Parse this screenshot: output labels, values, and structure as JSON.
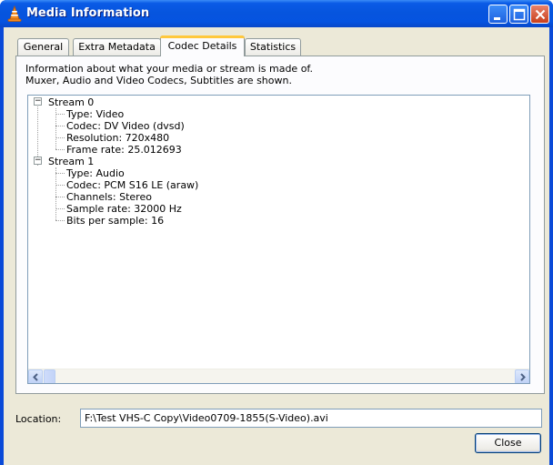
{
  "window": {
    "title": "Media Information",
    "controls": [
      "minimize-icon",
      "maximize-icon",
      "close-icon"
    ]
  },
  "tabs": [
    {
      "label": "General",
      "active": false
    },
    {
      "label": "Extra Metadata",
      "active": false
    },
    {
      "label": "Codec Details",
      "active": true
    },
    {
      "label": "Statistics",
      "active": false
    }
  ],
  "codec": {
    "info_line1": "Information about what your media or stream is made of.",
    "info_line2": "Muxer, Audio and Video Codecs, Subtitles are shown.",
    "streams": [
      {
        "label": "Stream 0",
        "expander": "−",
        "details": [
          "Type: Video",
          "Codec: DV Video (dvsd)",
          "Resolution: 720x480",
          "Frame rate: 25.012693"
        ]
      },
      {
        "label": "Stream 1",
        "expander": "−",
        "details": [
          "Type: Audio",
          "Codec: PCM S16 LE (araw)",
          "Channels: Stereo",
          "Sample rate: 32000 Hz",
          "Bits per sample: 16"
        ]
      }
    ]
  },
  "location": {
    "label": "Location:",
    "value": "F:\\Test VHS-C Copy\\Video0709-1855(S-Video).avi"
  },
  "buttons": {
    "close": "Close"
  },
  "colors": {
    "titlebar": "#0655de",
    "active_tab_highlight": "#ffc83c",
    "dialog_bg": "#ece9d8"
  }
}
